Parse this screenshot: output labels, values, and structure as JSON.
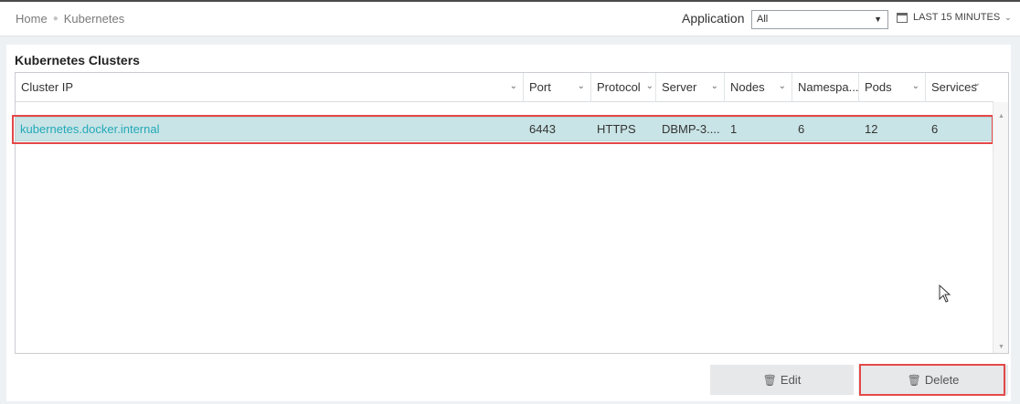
{
  "breadcrumb": {
    "home": "Home",
    "current": "Kubernetes"
  },
  "header": {
    "application_label": "Application",
    "application_value": "All",
    "time_range": "LAST 15 MINUTES"
  },
  "panel": {
    "title": "Kubernetes Clusters"
  },
  "table": {
    "columns": [
      "Cluster IP",
      "Port",
      "Protocol",
      "Server",
      "Nodes",
      "Namespa...",
      "Pods",
      "Services"
    ],
    "rows": [
      {
        "cluster_ip": "kubernetes.docker.internal",
        "port": "6443",
        "protocol": "HTTPS",
        "server": "DBMP-3....",
        "nodes": "1",
        "namespaces": "6",
        "pods": "12",
        "services": "6"
      }
    ]
  },
  "buttons": {
    "edit": "Edit",
    "delete": "Delete"
  },
  "icons": {
    "calendar": "calendar-icon",
    "trash": "trash-icon",
    "chevron": "chevron-down-icon"
  },
  "colors": {
    "accent_link": "#24a8b8",
    "selected_row": "#c9e4e6",
    "highlight_border": "#e44848"
  }
}
